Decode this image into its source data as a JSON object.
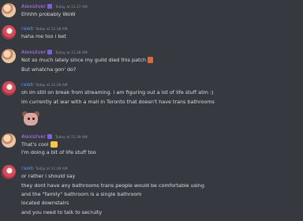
{
  "users": {
    "alex": {
      "name": "Alexsilver"
    },
    "rawb": {
      "name": "rawb"
    }
  },
  "messages": [
    {
      "user": "Alexsilver",
      "time": "Today at 11:37 AM",
      "lines": [
        "Ehhhh probably WoW"
      ]
    },
    {
      "user": "rawb",
      "time": "Today at 11:38 AM",
      "lines": [
        "haha me too i bet"
      ]
    },
    {
      "user": "Alexsilver",
      "time": "Today at 11:38 AM",
      "lines": [
        "Not so much lately since my guild died this patch",
        "But whatcha gon' do?"
      ]
    },
    {
      "user": "rawb",
      "time": "Today at 11:39 AM",
      "lines": [
        "oh im still on break from streaming. i am figuring out a lot of life stuff atm :)",
        "im currently at war with a mall in Toronto that doesn't have trans bathrooms"
      ]
    },
    {
      "user": "Alexsilver",
      "time": "Today at 11:39 AM",
      "lines": [
        "That's cool",
        "I'm doing a bit of life stuff too"
      ]
    },
    {
      "user": "rawb",
      "time": "Today at 11:39 AM",
      "lines": [
        "or rather i should say",
        "they dont have any bathrooms trans people would be comfortable using",
        "and the \"family\" bathroom is a single bathroom",
        "located downstairs",
        "and you need to talk to secruity"
      ]
    }
  ],
  "colors": {
    "background": "#36393f",
    "alex_name": "#b37fe8",
    "rawb_name": "#5a8ef0",
    "timestamp": "#8e9297",
    "text": "#dcddde"
  }
}
